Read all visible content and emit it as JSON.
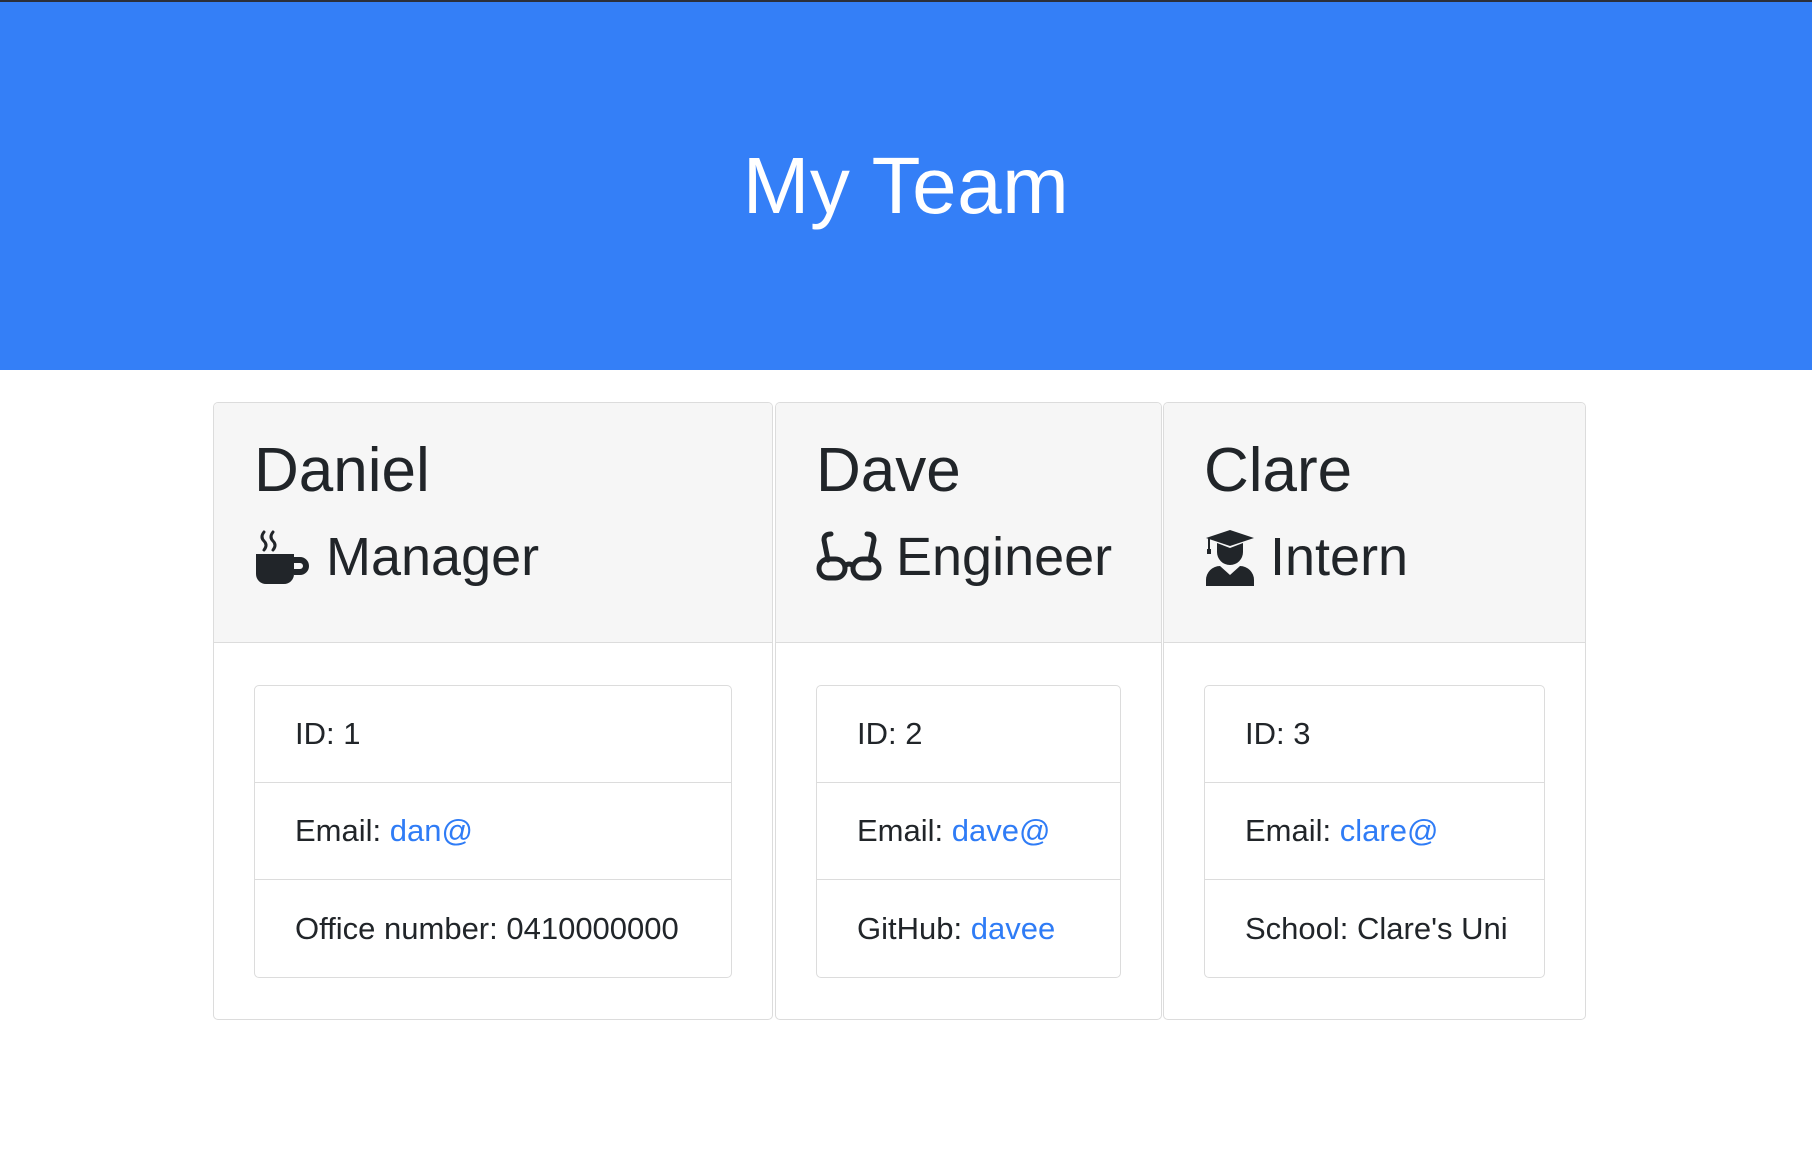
{
  "header": {
    "title": "My Team"
  },
  "colors": {
    "header_bg": "#347ff7",
    "link": "#2f7cf6"
  },
  "cards": [
    {
      "name": "Daniel",
      "role": "Manager",
      "role_icon": "coffee-mug-icon",
      "id_label": "ID: 1",
      "email_prefix": "Email: ",
      "email": "dan@",
      "extra_prefix": "Office number: 0410000000",
      "extra_link": ""
    },
    {
      "name": "Dave",
      "role": "Engineer",
      "role_icon": "glasses-icon",
      "id_label": "ID: 2",
      "email_prefix": "Email: ",
      "email": "dave@",
      "extra_prefix": "GitHub: ",
      "extra_link": "davee"
    },
    {
      "name": "Clare",
      "role": "Intern",
      "role_icon": "graduate-icon",
      "id_label": "ID: 3",
      "email_prefix": "Email: ",
      "email": "clare@",
      "extra_prefix": "School: Clare's Uni",
      "extra_link": ""
    }
  ]
}
